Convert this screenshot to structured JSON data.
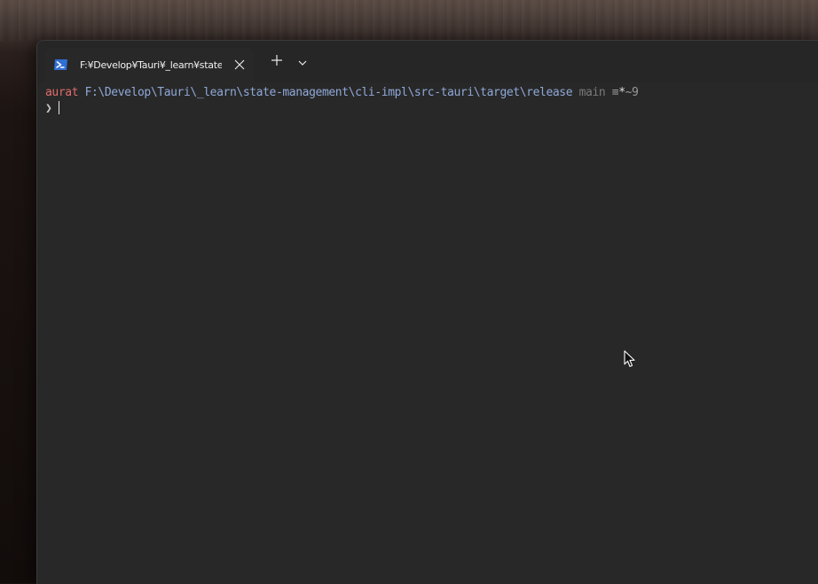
{
  "tab": {
    "title": "F:¥Develop¥Tauri¥_learn¥state-management¥cli-impl¥src-tauri¥target¥release",
    "icon": "powershell-icon"
  },
  "toolbar": {
    "new_tab_icon": "plus-icon",
    "dropdown_icon": "chevron-down-icon",
    "close_icon": "close-icon"
  },
  "prompt": {
    "user": "aurat",
    "path": "F:\\Develop\\Tauri\\_learn\\state-management\\cli-impl\\src-tauri\\target\\release",
    "branch": "main",
    "status_prefix": "≡",
    "status_star": "*",
    "status_suffix": "~9",
    "symbol": "❯"
  },
  "colors": {
    "user": "#e06c6c",
    "path": "#8fa8d8",
    "background": "#282828"
  }
}
